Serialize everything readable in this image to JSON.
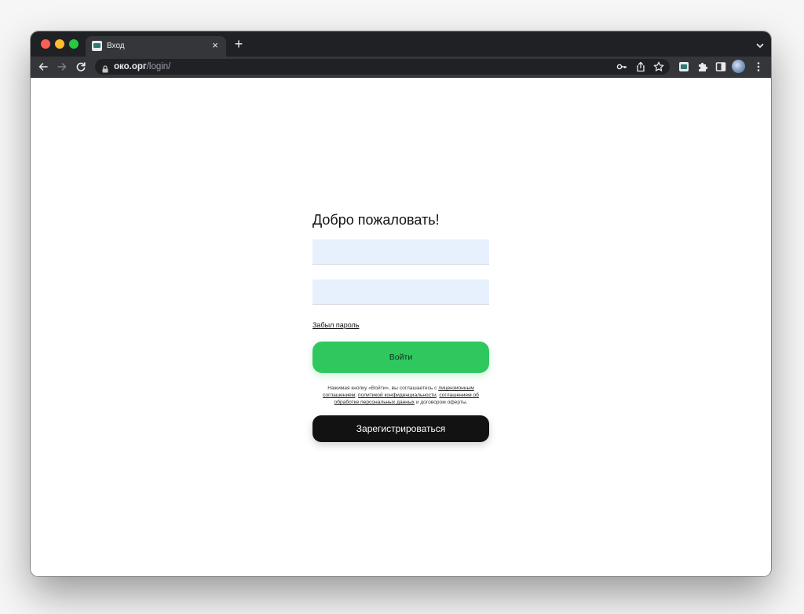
{
  "browser": {
    "tab": {
      "title": "Вход",
      "close_symbol": "×"
    },
    "new_tab_symbol": "+",
    "address": {
      "host": "око.орг",
      "path": "/login/"
    }
  },
  "login": {
    "heading": "Добро пожаловать!",
    "login_field": {
      "value": "",
      "placeholder": ""
    },
    "password_field": {
      "value": "",
      "placeholder": ""
    },
    "forgot_password": "Забыл пароль",
    "submit_label": "Войти",
    "terms": {
      "prefix": "Нажимая кнопку «Войти», вы соглашаетесь с ",
      "license_link": "лицензионным соглашением",
      "sep1": ", ",
      "privacy_link": "политикой конфиденциальности",
      "sep2": ", ",
      "data_link": "соглашением об обработке персональных данных",
      "suffix": " и договором оферты."
    },
    "register_label": "Зарегистрироваться"
  },
  "colors": {
    "primary_button": "#2fc85f",
    "secondary_button": "#121212",
    "input_background": "#e7f0fd"
  }
}
